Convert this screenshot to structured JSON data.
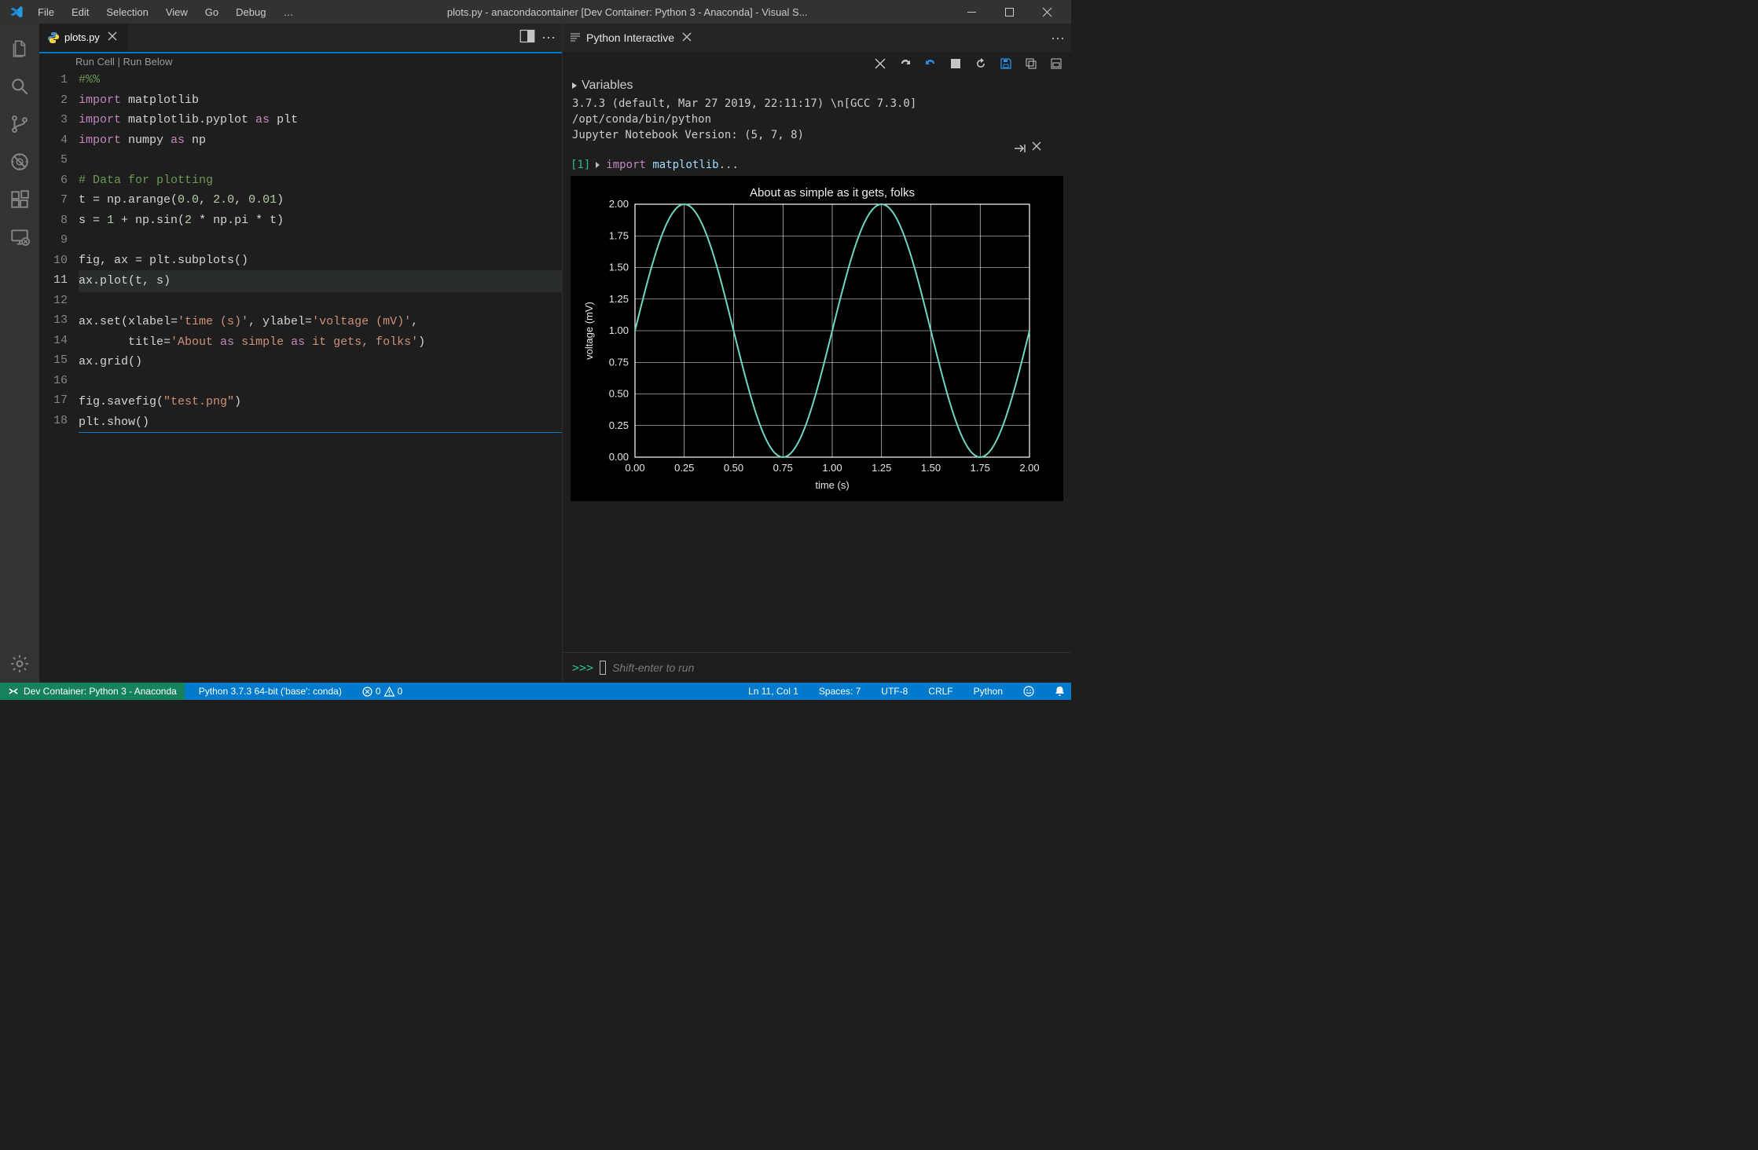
{
  "window": {
    "title": "plots.py - anacondacontainer [Dev Container: Python 3 - Anaconda] - Visual S..."
  },
  "menu": [
    "File",
    "Edit",
    "Selection",
    "View",
    "Go",
    "Debug",
    "…"
  ],
  "tabs": {
    "editor": {
      "label": "plots.py"
    },
    "interactive": {
      "label": "Python Interactive"
    }
  },
  "codelens": {
    "run_cell": "Run Cell",
    "run_below": "Run Below"
  },
  "code_lines_raw": [
    "#%%",
    "import matplotlib",
    "import matplotlib.pyplot as plt",
    "import numpy as np",
    "",
    "# Data for plotting",
    "t = np.arange(0.0, 2.0, 0.01)",
    "s = 1 + np.sin(2 * np.pi * t)",
    "",
    "fig, ax = plt.subplots()",
    "ax.plot(t, s)",
    "",
    "ax.set(xlabel='time (s)', ylabel='voltage (mV)',",
    "       title='About as simple as it gets, folks')",
    "ax.grid()",
    "",
    "fig.savefig(\"test.png\")",
    "plt.show()"
  ],
  "current_line": 11,
  "interactive": {
    "variables_label": "Variables",
    "env_line1": "3.7.3 (default, Mar 27 2019, 22:11:17) \\n[GCC 7.3.0]",
    "env_line2": "/opt/conda/bin/python",
    "env_line3": "Jupyter Notebook Version: (5, 7, 8)",
    "cell_num": "[1]",
    "cell_code_kw": "import",
    "cell_code_mod": "matplotlib",
    "cell_code_tail": "...",
    "input_prompt": ">>>",
    "input_placeholder": "Shift-enter to run"
  },
  "chart_data": {
    "type": "line",
    "title": "About as simple as it gets, folks",
    "xlabel": "time (s)",
    "ylabel": "voltage (mV)",
    "xlim": [
      0.0,
      2.0
    ],
    "ylim": [
      0.0,
      2.0
    ],
    "xticks": [
      0.0,
      0.25,
      0.5,
      0.75,
      1.0,
      1.25,
      1.5,
      1.75,
      2.0
    ],
    "yticks": [
      0.0,
      0.25,
      0.5,
      0.75,
      1.0,
      1.25,
      1.5,
      1.75,
      2.0
    ],
    "series": [
      {
        "name": "s",
        "formula": "1 + sin(2*pi*t)",
        "x_start": 0.0,
        "x_end": 2.0,
        "step": 0.01,
        "color": "#6fd6c4"
      }
    ],
    "grid": true
  },
  "status": {
    "remote": "Dev Container: Python 3 - Anaconda",
    "interpreter": "Python 3.7.3 64-bit ('base': conda)",
    "errors": "0",
    "warnings": "0",
    "cursor": "Ln 11, Col 1",
    "indent": "Spaces: 7",
    "encoding": "UTF-8",
    "eol": "CRLF",
    "language": "Python"
  }
}
